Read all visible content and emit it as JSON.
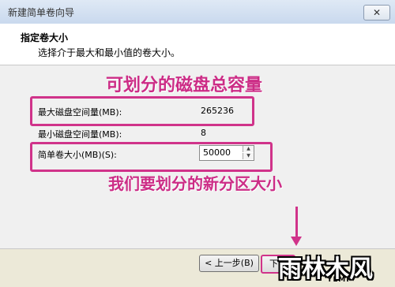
{
  "window": {
    "title": "新建简单卷向导",
    "close_label": "✕"
  },
  "header": {
    "title": "指定卷大小",
    "subtitle": "选择介于最大和最小值的卷大小。"
  },
  "annotations": {
    "total_capacity": "可划分的磁盘总容量",
    "new_partition_size": "我们要划分的新分区大小"
  },
  "fields": {
    "max_label": "最大磁盘空间量(MB):",
    "max_value": "265236",
    "min_label": "最小磁盘空间量(MB):",
    "min_value": "8",
    "size_label": "简单卷大小(MB)(S):",
    "size_value": "50000"
  },
  "buttons": {
    "back": "< 上一步(B)",
    "next": "下一"
  },
  "watermark": {
    "main": "雨林木风",
    "sub": "YLMF"
  },
  "colors": {
    "annotation": "#d0338a"
  }
}
